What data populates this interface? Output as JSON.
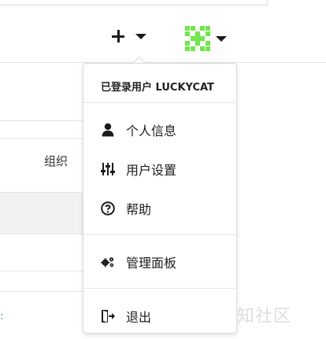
{
  "header": {
    "create_icon": "plus-icon",
    "create_dropdown_icon": "caret-down-icon",
    "avatar_icon": "identicon-avatar",
    "avatar_color": "#6ee84a",
    "avatar_dropdown_icon": "caret-down-icon"
  },
  "background": {
    "column_label": "组织"
  },
  "user_menu": {
    "signed_in_as": "已登录用户 LUCKYCAT",
    "items": [
      {
        "label": "个人信息",
        "icon": "user-icon"
      },
      {
        "label": "用户设置",
        "icon": "sliders-icon"
      },
      {
        "label": "帮助",
        "icon": "question-circle-icon"
      },
      {
        "label": "管理面板",
        "icon": "cogs-icon"
      },
      {
        "label": "退出",
        "icon": "sign-out-icon"
      }
    ]
  },
  "watermark": {
    "text": "先知社区"
  }
}
